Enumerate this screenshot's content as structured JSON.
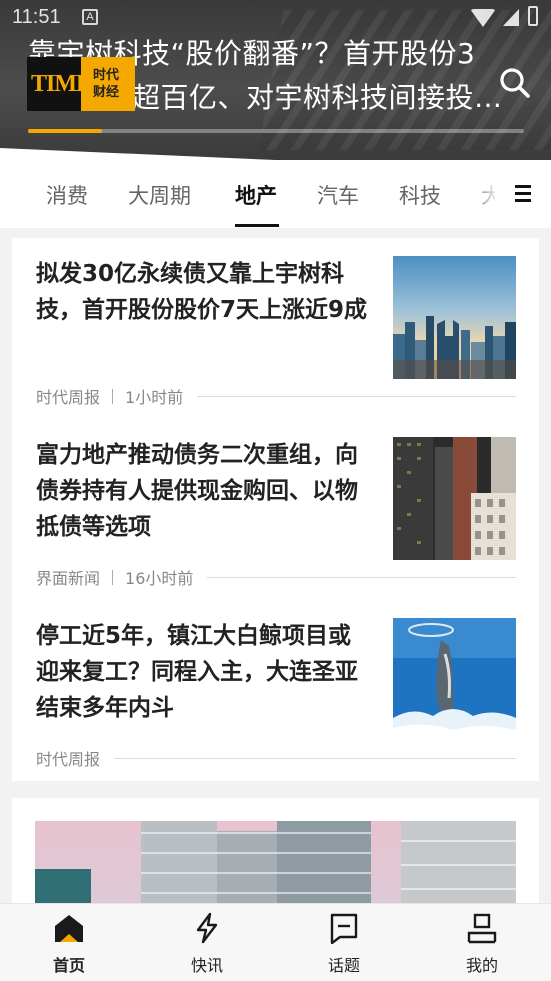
{
  "status_bar": {
    "time": "11:51",
    "notification_icon": "A"
  },
  "banner": {
    "headline_line1": "靠宇树科技“股价翻番”？首开股份3",
    "headline_line2": "超百亿、对宇树科技间接投…",
    "logo": {
      "wordmark": "TIME",
      "small_text": "时代",
      "cn_line1": "时代",
      "cn_line2": "财经"
    },
    "carousel_progress": 0.15,
    "search_icon": "search-icon",
    "accent_color": "#f5a800"
  },
  "tabs": {
    "items": [
      "消费",
      "大周期",
      "地产",
      "汽车",
      "科技",
      "大"
    ],
    "active": "地产",
    "menu_icon": "menu-icon"
  },
  "news": [
    {
      "title": "拟发30亿永续债又靠上宇树科技，首开股份股价7天上涨近9成",
      "source": "时代周报",
      "time": "1小时前",
      "image": "city-skyline-photo"
    },
    {
      "title": "富力地产推动债务二次重组，向债券持有人提供现金购回、以物抵债等选项",
      "source": "界面新闻",
      "time": "16小时前",
      "image": "skyscrapers-photo"
    },
    {
      "title": "停工近5年，镇江大白鲸项目或迎来复工？同程入主，大连圣亚结束多年内斗",
      "source": "时代周报",
      "time": "",
      "image": "dolphin-photo"
    }
  ],
  "bottom_nav": {
    "items": [
      {
        "label": "首页",
        "icon": "home-icon"
      },
      {
        "label": "快讯",
        "icon": "lightning-icon"
      },
      {
        "label": "话题",
        "icon": "topic-icon"
      },
      {
        "label": "我的",
        "icon": "profile-icon"
      }
    ],
    "active": "首页"
  }
}
